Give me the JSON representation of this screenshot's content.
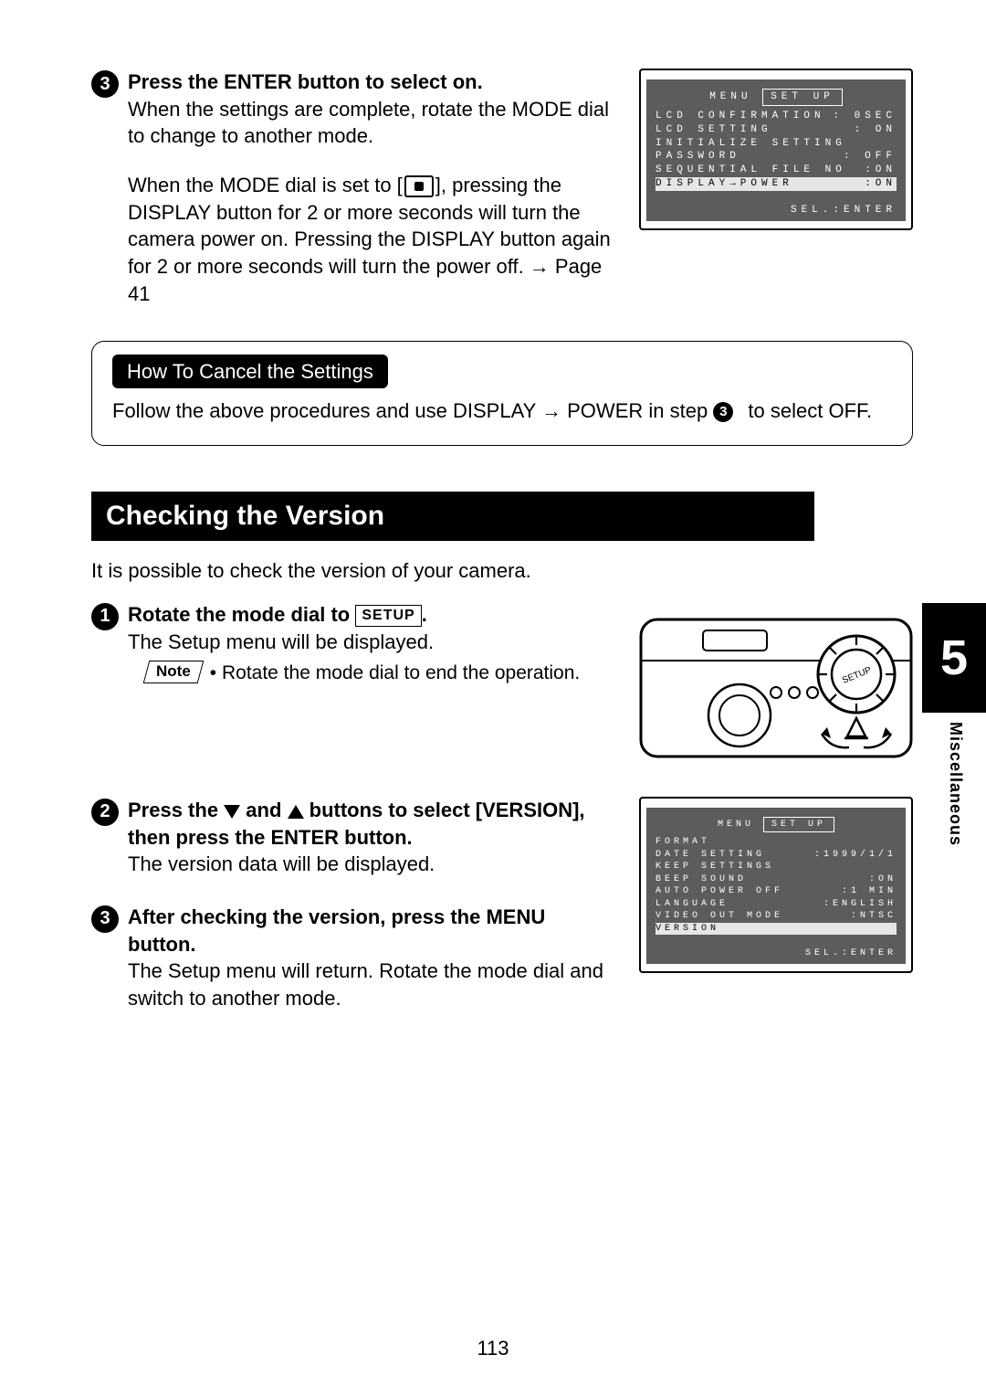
{
  "step3": {
    "num": "3",
    "title": "Press the ENTER button to select on.",
    "para1": "When the settings are complete, rotate the MODE dial to change to another mode.",
    "para2a": "When the MODE dial is set to [",
    "para2b": "], pressing the DISPLAY button for 2 or more seconds will turn the camera power on. Pressing the DISPLAY button again for 2 or more seconds will turn the power off. → Page 41"
  },
  "screen1": {
    "menuLabel": "MENU",
    "titleBox": "SET UP",
    "rows": [
      {
        "l": "LCD CONFIRMATION",
        "r": ": 0SEC"
      },
      {
        "l": "LCD SETTING",
        "r": ": ON"
      },
      {
        "l": "INITIALIZE SETTING",
        "r": ""
      },
      {
        "l": "PASSWORD",
        "r": ": OFF"
      },
      {
        "l": "SEQUENTIAL FILE NO",
        "r": ":ON"
      }
    ],
    "hl": {
      "l": "DISPLAY→POWER",
      "r": ":ON"
    },
    "foot": "SEL.:ENTER"
  },
  "cancel": {
    "pill": "How To Cancel the Settings",
    "textA": "Follow the above procedures and use DISPLAY → POWER in step ",
    "textB": " to select OFF.",
    "inlineNum": "3"
  },
  "sectionTitle": "Checking the Version",
  "intro": "It is possible to check the version of your camera.",
  "v1": {
    "num": "1",
    "titleA": "Rotate the mode dial to ",
    "setup": "SETUP",
    "titleB": ".",
    "body": "The Setup menu will be displayed.",
    "noteLabel": "Note",
    "noteText": "• Rotate the mode dial to end the operation."
  },
  "v2": {
    "num": "2",
    "titleA": "Press the ",
    "titleB": " and ",
    "titleC": " buttons to select [VERSION], then press the ENTER button.",
    "body": "The version data will be displayed."
  },
  "v3": {
    "num": "3",
    "title": "After checking the version, press the MENU button.",
    "body": "The Setup menu will return. Rotate the mode dial and switch to another mode."
  },
  "screen2": {
    "menuLabel": "MENU",
    "titleBox": "SET UP",
    "rows": [
      {
        "l": "FORMAT",
        "r": ""
      },
      {
        "l": "DATE SETTING",
        "r": ":1999/1/1"
      },
      {
        "l": "KEEP SETTINGS",
        "r": ""
      },
      {
        "l": "BEEP SOUND",
        "r": ":ON"
      },
      {
        "l": "AUTO POWER OFF",
        "r": ":1 MIN"
      },
      {
        "l": "LANGUAGE",
        "r": ":ENGLISH"
      },
      {
        "l": "VIDEO OUT MODE",
        "r": ":NTSC"
      }
    ],
    "hl": {
      "l": "VERSION",
      "r": ""
    },
    "foot": "SEL.:ENTER"
  },
  "sideTab": {
    "num": "5",
    "label": "Miscellaneous"
  },
  "pageNum": "113",
  "camLabel": "SETUP"
}
